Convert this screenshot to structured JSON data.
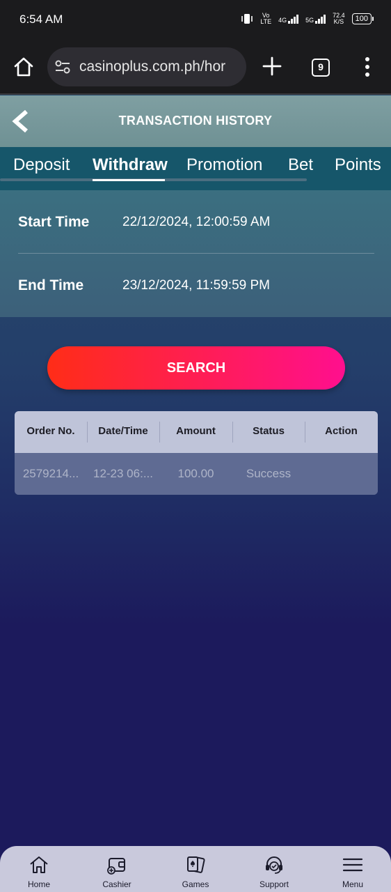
{
  "status_bar": {
    "time": "6:54 AM",
    "volte_top": "Vo",
    "volte_bottom": "LTE",
    "net_4g": "4G",
    "net_5g": "5G",
    "speed_top": "72.4",
    "speed_bottom": "K/S",
    "battery": "100"
  },
  "browser": {
    "url": "casinoplus.com.ph/hor",
    "tab_count": "9"
  },
  "header": {
    "title": "TRANSACTION HISTORY"
  },
  "tabs": [
    {
      "label": "Deposit"
    },
    {
      "label": "Withdraw"
    },
    {
      "label": "Promotion"
    },
    {
      "label": "Bet"
    },
    {
      "label": "Points"
    }
  ],
  "active_tab": "Withdraw",
  "filters": {
    "start_label": "Start Time",
    "start_value": "22/12/2024, 12:00:59 AM",
    "end_label": "End Time",
    "end_value": "23/12/2024, 11:59:59 PM"
  },
  "search_label": "SEARCH",
  "table": {
    "headers": [
      "Order No.",
      "Date/Time",
      "Amount",
      "Status",
      "Action"
    ],
    "rows": [
      [
        "2579214...",
        "12-23 06:...",
        "100.00",
        "Success",
        ""
      ]
    ]
  },
  "bottom_nav": [
    {
      "label": "Home",
      "icon": "home-icon"
    },
    {
      "label": "Cashier",
      "icon": "wallet-icon"
    },
    {
      "label": "Games",
      "icon": "cards-icon"
    },
    {
      "label": "Support",
      "icon": "headset-icon"
    },
    {
      "label": "Menu",
      "icon": "hamburger-icon"
    }
  ]
}
